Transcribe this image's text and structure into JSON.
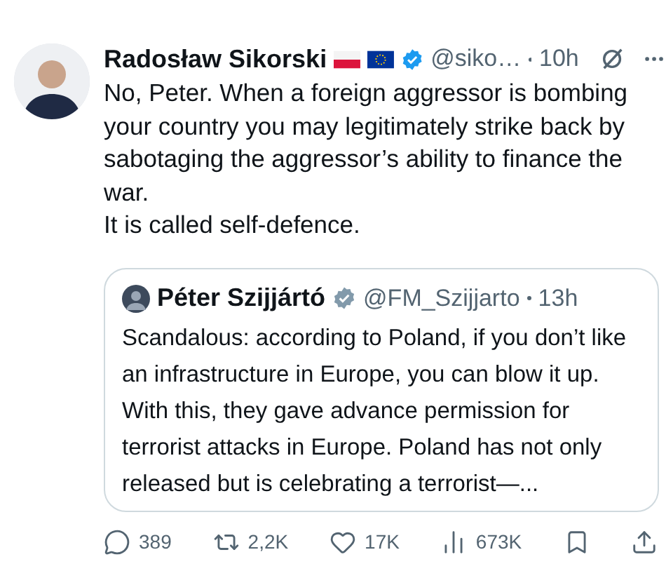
{
  "tweet": {
    "author": {
      "name": "Radosław Sikorski",
      "handle": "@siko…",
      "time": "10h"
    },
    "paragraphs": [
      "No, Peter. When a foreign aggressor is bombing your country you may legitimately strike back by sabotaging the aggressor’s ability to finance the war.",
      "It is called self-defence."
    ],
    "quote": {
      "name": "Péter Szijjártó",
      "handle": "@FM_Szijjarto",
      "time": "13h",
      "text": "Scandalous: according to Poland, if you don’t like an infrastructure in Europe, you can blow it up. With this, they gave advance permission for terrorist attacks in Europe. Poland has not only released but is celebrating a terrorist—..."
    },
    "actions": [
      {
        "kind": "reply",
        "count": "389"
      },
      {
        "kind": "repost",
        "count": "2,2K"
      },
      {
        "kind": "like",
        "count": "17K"
      },
      {
        "kind": "views",
        "count": "673K"
      },
      {
        "kind": "bookmark"
      },
      {
        "kind": "share"
      }
    ]
  }
}
